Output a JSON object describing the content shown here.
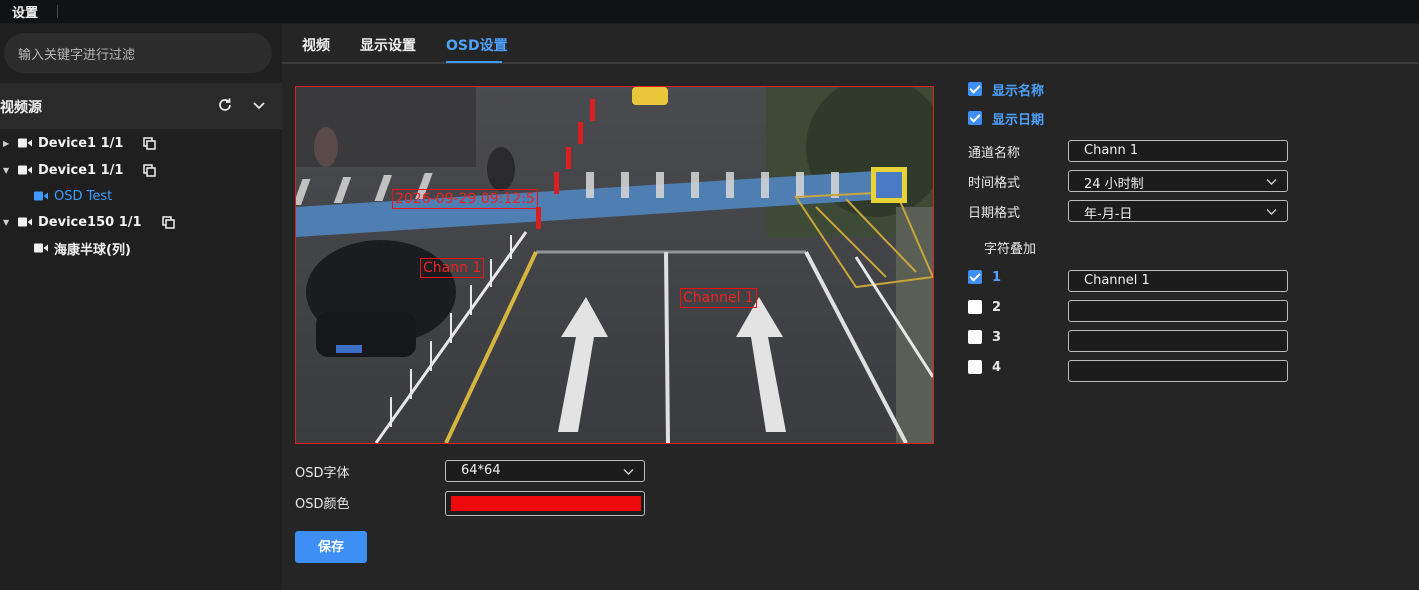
{
  "window": {
    "title": "设置"
  },
  "sidebar": {
    "search_placeholder": "输入关键字进行过滤",
    "source_title": "视频源",
    "tree": [
      {
        "label": "Device1 1/1",
        "expanded": false,
        "has_copy": true
      },
      {
        "label": "Device1 1/1",
        "expanded": true,
        "has_copy": true
      },
      {
        "label": "OSD Test",
        "child": true,
        "active": true
      },
      {
        "label": "Device150 1/1",
        "expanded": true,
        "has_copy": true
      },
      {
        "label": "海康半球(列)",
        "child": true,
        "active": false
      }
    ]
  },
  "tabs": [
    {
      "label": "视频",
      "active": false
    },
    {
      "label": "显示设置",
      "active": false
    },
    {
      "label": "OSD设置",
      "active": true
    }
  ],
  "preview": {
    "osd_date": "2026-09-29 09:12:5",
    "osd_name": "Chann 1",
    "osd_overlay1": "Channel 1"
  },
  "osd_form": {
    "font_label": "OSD字体",
    "font_value": "64*64",
    "color_label": "OSD颜色",
    "color_value": "#ee0a0a",
    "save_label": "保存"
  },
  "settings": {
    "show_name": {
      "label": "显示名称",
      "checked": true
    },
    "show_date": {
      "label": "显示日期",
      "checked": true
    },
    "channel_name_label": "通道名称",
    "channel_name_value": "Chann 1",
    "time_format_label": "时间格式",
    "time_format_value": "24 小时制",
    "date_format_label": "日期格式",
    "date_format_value": "年-月-日",
    "overlay_title": "字符叠加",
    "overlays": [
      {
        "num": "1",
        "checked": true,
        "value": "Channel 1"
      },
      {
        "num": "2",
        "checked": false,
        "value": ""
      },
      {
        "num": "3",
        "checked": false,
        "value": ""
      },
      {
        "num": "4",
        "checked": false,
        "value": ""
      }
    ]
  },
  "colors": {
    "accent": "#3d8ff5",
    "osd_red": "#ee1111"
  }
}
